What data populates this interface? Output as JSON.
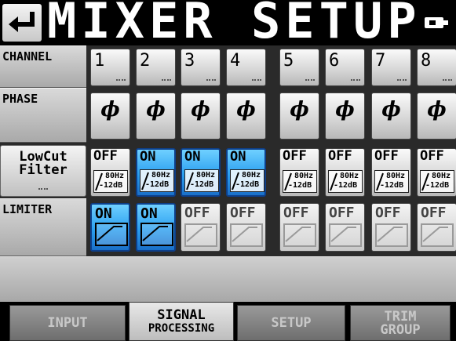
{
  "header": {
    "title": "MIXER SETUP",
    "back_icon": "return-arrow-icon",
    "battery_icon": "battery-icon"
  },
  "rows": {
    "channel_label": "CHANNEL",
    "phase_label": "PHASE",
    "lowcut_label_line1": "LowCut",
    "lowcut_label_line2": "Filter",
    "limiter_label": "LIMITER"
  },
  "channels": [
    {
      "num": "1",
      "phase": "ϕ",
      "lowcut": "OFF",
      "lowcut_freq": "80Hz",
      "lowcut_db": "-12dB",
      "limiter": "ON"
    },
    {
      "num": "2",
      "phase": "ϕ",
      "lowcut": "ON",
      "lowcut_freq": "80Hz",
      "lowcut_db": "-12dB",
      "limiter": "ON"
    },
    {
      "num": "3",
      "phase": "ϕ",
      "lowcut": "ON",
      "lowcut_freq": "80Hz",
      "lowcut_db": "-12dB",
      "limiter": "OFF"
    },
    {
      "num": "4",
      "phase": "ϕ",
      "lowcut": "ON",
      "lowcut_freq": "80Hz",
      "lowcut_db": "-12dB",
      "limiter": "OFF"
    },
    {
      "num": "5",
      "phase": "ϕ",
      "lowcut": "OFF",
      "lowcut_freq": "80Hz",
      "lowcut_db": "-12dB",
      "limiter": "OFF"
    },
    {
      "num": "6",
      "phase": "ϕ",
      "lowcut": "OFF",
      "lowcut_freq": "80Hz",
      "lowcut_db": "-12dB",
      "limiter": "OFF"
    },
    {
      "num": "7",
      "phase": "ϕ",
      "lowcut": "OFF",
      "lowcut_freq": "80Hz",
      "lowcut_db": "-12dB",
      "limiter": "OFF"
    },
    {
      "num": "8",
      "phase": "ϕ",
      "lowcut": "OFF",
      "lowcut_freq": "80Hz",
      "lowcut_db": "-12dB",
      "limiter": "OFF"
    }
  ],
  "tabs": [
    {
      "line1": "INPUT",
      "line2": ""
    },
    {
      "line1": "SIGNAL",
      "line2": "PROCESSING"
    },
    {
      "line1": "SETUP",
      "line2": ""
    },
    {
      "line1": "TRIM",
      "line2": "GROUP"
    }
  ],
  "active_tab": 1,
  "colors": {
    "on": "#2b9ff0",
    "off": "#d4d4d4",
    "background": "#000000"
  }
}
